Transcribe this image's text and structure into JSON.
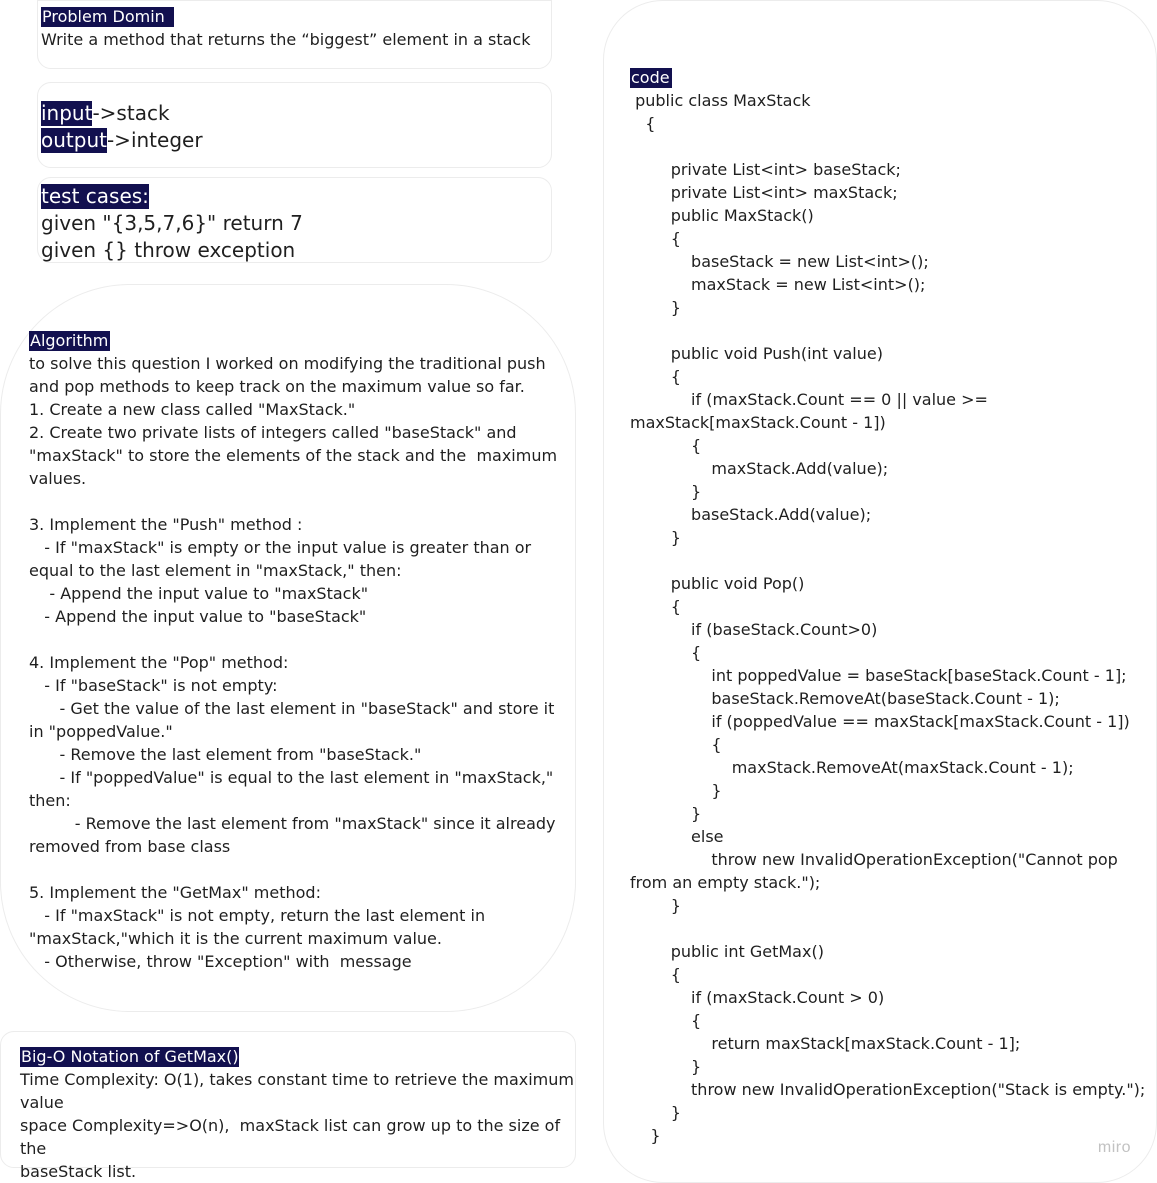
{
  "problem": {
    "heading": "Problem Domin",
    "text": "Write a method that returns the “biggest” element in a stack"
  },
  "io": {
    "input_label": "input",
    "input_value": "->stack",
    "output_label": "output",
    "output_value": "->integer"
  },
  "tests": {
    "heading": "test cases:",
    "lines": [
      "given \"{3,5,7,6}\" return 7",
      "given {} throw exception"
    ]
  },
  "algorithm": {
    "heading": "Algorithm",
    "text": "to solve this question I worked on modifying the traditional push\nand pop methods to keep track on the maximum value so far.\n1. Create a new class called \"MaxStack.\"\n2. Create two private lists of integers called \"baseStack\" and\n\"maxStack\" to store the elements of the stack and the  maximum\nvalues.\n\n3. Implement the \"Push\" method :\n   - If \"maxStack\" is empty or the input value is greater than or\nequal to the last element in \"maxStack,\" then:\n    - Append the input value to \"maxStack\"\n   - Append the input value to \"baseStack\"\n\n4. Implement the \"Pop\" method:\n   - If \"baseStack\" is not empty:\n      - Get the value of the last element in \"baseStack\" and store it\nin \"poppedValue.\"\n      - Remove the last element from \"baseStack.\"\n      - If \"poppedValue\" is equal to the last element in \"maxStack,\"\nthen:\n         - Remove the last element from \"maxStack\" since it already\nremoved from base class\n\n5. Implement the \"GetMax\" method:\n   - If \"maxStack\" is not empty, return the last element in\n\"maxStack,\"which it is the current maximum value.\n   - Otherwise, throw \"Exception\" with  message"
  },
  "bigo": {
    "heading": "Big-O Notation of GetMax()",
    "text": "Time Complexity: O(1), takes constant time to retrieve the maximum\nvalue\nspace Complexity=>O(n),  maxStack list can grow up to the size of the\nbaseStack list."
  },
  "code": {
    "heading": "  code",
    "text": " public class MaxStack\n   {\n\n        private List<int> baseStack;\n        private List<int> maxStack;\n        public MaxStack()\n        {\n            baseStack = new List<int>();\n            maxStack = new List<int>();\n        }\n\n        public void Push(int value)\n        {\n            if (maxStack.Count == 0 || value >=\nmaxStack[maxStack.Count - 1])\n            {\n                maxStack.Add(value);\n            }\n            baseStack.Add(value);\n        }\n\n        public void Pop()\n        {\n            if (baseStack.Count>0)\n            {\n                int poppedValue = baseStack[baseStack.Count - 1];\n                baseStack.RemoveAt(baseStack.Count - 1);\n                if (poppedValue == maxStack[maxStack.Count - 1])\n                {\n                    maxStack.RemoveAt(maxStack.Count - 1);\n                }\n            }\n            else\n                throw new InvalidOperationException(\"Cannot pop\nfrom an empty stack.\");\n        }\n\n        public int GetMax()\n        {\n            if (maxStack.Count > 0)\n            {\n                return maxStack[maxStack.Count - 1];\n            }\n            throw new InvalidOperationException(\"Stack is empty.\");\n        }\n    }"
  },
  "watermark": "miro"
}
